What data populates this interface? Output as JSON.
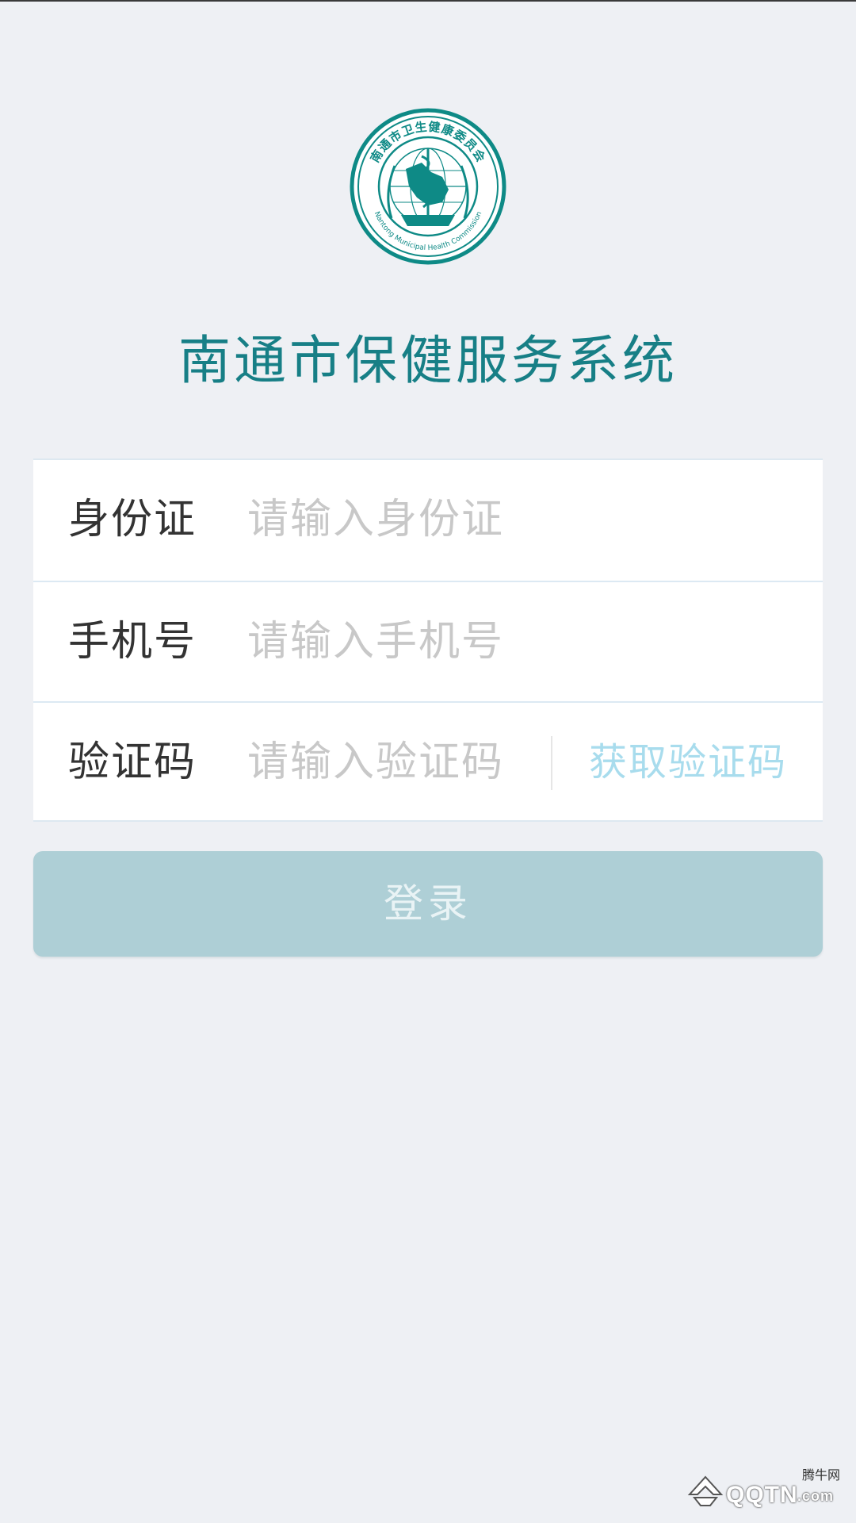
{
  "logo": {
    "name": "municipal-health-commission-seal",
    "cn_text": "南通市卫生健康委员会",
    "en_text": "Nantong Municipal Health Commission",
    "color": "#0e8a86"
  },
  "app_title": "南通市保健服务系统",
  "form": {
    "id_card": {
      "label": "身份证",
      "placeholder": "请输入身份证",
      "value": ""
    },
    "phone": {
      "label": "手机号",
      "placeholder": "请输入手机号",
      "value": ""
    },
    "code": {
      "label": "验证码",
      "placeholder": "请输入验证码",
      "value": "",
      "get_code_label": "获取验证码"
    }
  },
  "login_button": {
    "label": "登录"
  },
  "colors": {
    "background": "#eef0f4",
    "title": "#177f86",
    "button": "#aecfd6",
    "get_code": "#a8dced"
  },
  "watermark": {
    "text": "QQTN",
    "suffix": ".com",
    "small": "腾牛网"
  }
}
